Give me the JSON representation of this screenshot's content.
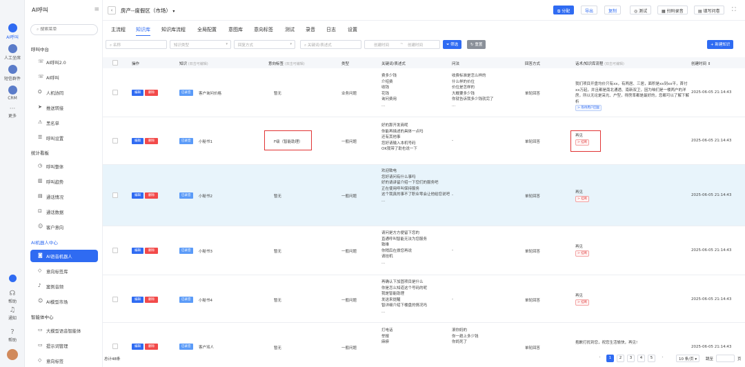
{
  "rail": {
    "items": [
      {
        "label": "AI呼叫",
        "active": true
      },
      {
        "label": "人工坐席"
      },
      {
        "label": "短信群件"
      },
      {
        "label": "CRM"
      },
      {
        "label": "更多"
      }
    ],
    "bottom": [
      {
        "label": "帮助",
        "glyph": "●"
      },
      {
        "label": "消息",
        "glyph": "◌"
      },
      {
        "label": "通知",
        "glyph": "◌"
      },
      {
        "label": "帮助",
        "glyph": "◌"
      }
    ]
  },
  "sidebar": {
    "title": "AI呼叫",
    "search_placeholder": "搜索菜单",
    "sections": [
      {
        "title": "呼叫中台",
        "items": [
          "AI呼叫2.0",
          "AI呼叫",
          "人机协同",
          "推送转接",
          "黑名单",
          "呼叫设置"
        ]
      },
      {
        "title": "统计看板",
        "items": [
          "呼叫整体",
          "呼叫趋势",
          "通话情况",
          "通话数据",
          "客户意向"
        ]
      },
      {
        "title": "AI机器人中心",
        "items": [
          "AI语音机器人",
          "意向标签库",
          "案例音频",
          "AI模型市场"
        ]
      },
      {
        "title": "智能体中心",
        "items": [
          "大模型语音智能体",
          "提示词管理",
          "意向标签"
        ]
      }
    ],
    "active_item": "AI语音机器人"
  },
  "topbar": {
    "back": "‹",
    "title": "房产--度假区（市场）",
    "buttons": {
      "assign": "分配",
      "export": "导出",
      "copy": "复制",
      "test": "测试",
      "scan": "扫码录音",
      "feedback": "填写问卷"
    }
  },
  "tabs": [
    "主流程",
    "知识库",
    "知识库流程",
    "全局配置",
    "意图库",
    "意向标签",
    "测试",
    "录音",
    "日志",
    "设置"
  ],
  "active_tab": "知识库",
  "filters": {
    "name": "名称",
    "type": "知识类型",
    "reply": "回复方式",
    "keyword": "关键词/表述式",
    "start": "创建时间",
    "sep": "~",
    "end": "创建时间",
    "search_btn": "筛选",
    "reset_btn": "重置",
    "new_btn": "+ 新建知识"
  },
  "table": {
    "headers": {
      "op": "操作",
      "knowledge": "知识",
      "knowledge_hint": "(双击可编辑)",
      "intent": "意向标签",
      "intent_hint": "(双击可编辑)",
      "type": "类型",
      "keyword": "关键词/表述式",
      "question": "问法",
      "reply": "回答方式",
      "script": "话术/知识库流程",
      "script_hint": "(双击可编辑)",
      "created": "创建时间"
    },
    "edit_label": "编辑",
    "delete_label": "删除",
    "rows": [
      {
        "tag": "已录音",
        "name": "客户询问价格",
        "intent": "暂无",
        "type": "业务问题",
        "keywords": [
          "费多少钱",
          "介绍费",
          "收钱",
          "花钱",
          "询问费用",
          "..."
        ],
        "questions": [
          "收费标准是怎么样的",
          "什么样的价位",
          "价位是怎样的",
          "大概要多少钱",
          "你就告诉我多少钱就完了",
          "..."
        ],
        "reply": "单轮回答",
        "script": "我们项目开盘均价只有xx，有两居、三居，面积是xx到xx平，首付xx万起，并且都是南北通透、南新双卫，因为咱们是一楼两户的洋房，所以无论是采光、户型，得房率都是最好的，您都可以了解下解析",
        "link": "> 等待用户回复",
        "created": "2025-06-05 21:14:43"
      },
      {
        "tag": "已录音",
        "name": "小秘书1",
        "intent": "F级（智能助理）",
        "type": "一般问题",
        "keywords": [
          "好的那开发商呢",
          "你能再描述的具体一点吗",
          "还有其他事",
          "您好请输入本机号码",
          "OK我带了助也说一下"
        ],
        "questions": [
          "-"
        ],
        "reply": "单轮回答",
        "script": "再见",
        "link": "> 挂断",
        "created": "2025-06-05 21:14:43"
      },
      {
        "tag": "已录音",
        "name": "小秘书2",
        "intent": "暂无",
        "type": "一般问题",
        "keywords": [
          "欢迎致电",
          "您好请问有什么事吗",
          "好的请讲留介绍一下您们的服务吧",
          "正在使用呼叫保持服务",
          "这个我真的事不了职业零会让他给您说吧",
          "..."
        ],
        "questions": [
          "-"
        ],
        "reply": "单轮回答",
        "script": "再见",
        "link": "> 挂断",
        "created": "2025-06-05 21:14:43"
      },
      {
        "tag": "已录音",
        "name": "小秘书3",
        "intent": "暂无",
        "type": "一般问题",
        "keywords": [
          "请问是方方便留下您的",
          "直通呼叫智能无法为您服务",
          "致维",
          "你稍后在拨您再说",
          "请挂机",
          "..."
        ],
        "questions": [
          "-"
        ],
        "reply": "单轮回答",
        "script": "再见",
        "link": "> 挂断",
        "created": "2025-06-05 21:14:43"
      },
      {
        "tag": "已录音",
        "name": "小秘书4",
        "intent": "暂无",
        "type": "一般问题",
        "keywords": [
          "再确认下加固项目是什么",
          "你是怎么知道这个号码的呢",
          "我是智能助理",
          "发送来提醒",
          "智详细介绍下楼盘的情况吗",
          "..."
        ],
        "questions": [
          "-"
        ],
        "reply": "单轮回答",
        "script": "再见",
        "link": "> 挂断",
        "created": "2025-06-05 21:14:43"
      },
      {
        "tag": "已录音",
        "name": "客户骂人",
        "intent": "暂无",
        "type": "一般问题",
        "keywords": [
          "打电话",
          "举报",
          "麻痹"
        ],
        "questions": [
          "滚你妈的",
          "你一趟上多少钱",
          "你妈死了"
        ],
        "reply": "单轮回答",
        "script": "抱歉打扰到您，祝您生活愉快，再见!",
        "link": "",
        "created": "2025-06-05 21:14:43"
      }
    ]
  },
  "footer": {
    "total": "总计48条",
    "prev": "‹",
    "pages": [
      "1",
      "2",
      "3",
      "4",
      "5"
    ],
    "next": "›",
    "page_size": "10 条/页",
    "jump": "跳至",
    "jump_unit": "页"
  }
}
